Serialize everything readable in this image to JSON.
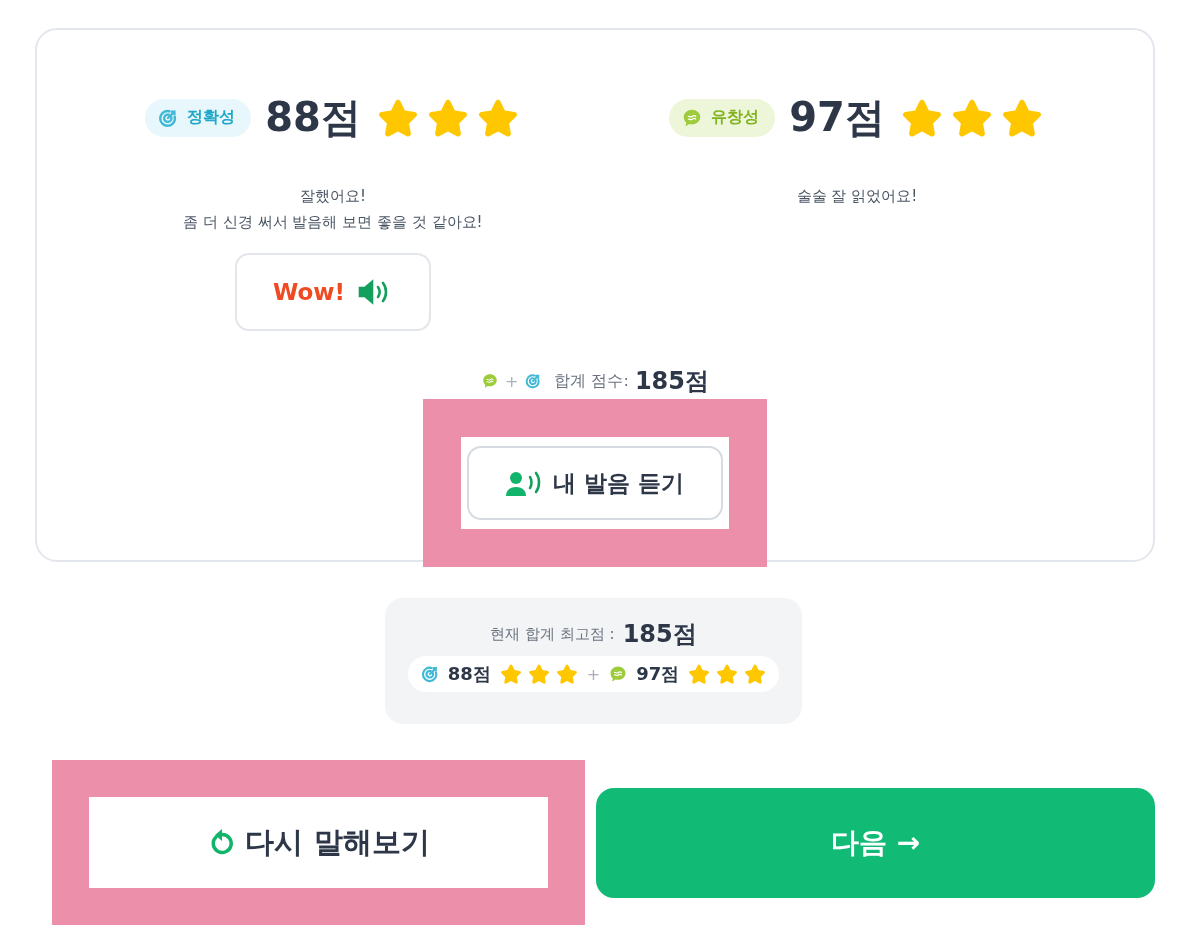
{
  "metrics": [
    {
      "kind": "accuracy",
      "label": "정확성",
      "score": "88점",
      "stars": 3,
      "feedback": [
        "잘했어요!",
        "좀 더 신경 써서 발음해 보면 좋을 것 같아요!"
      ],
      "sample_button": {
        "label": "Wow!"
      }
    },
    {
      "kind": "fluency",
      "label": "유창성",
      "score": "97점",
      "stars": 3,
      "feedback": [
        "술술 잘 읽었어요!"
      ]
    }
  ],
  "total": {
    "separator": "+",
    "label": "합계 점수:",
    "score": "185점"
  },
  "listen_button": {
    "label": "내 발음 듣기",
    "highlighted": true
  },
  "best": {
    "label": "현재 합계 최고점 :",
    "score": "185점",
    "separator": "+",
    "parts": [
      {
        "kind": "accuracy",
        "score": "88점",
        "stars": 3
      },
      {
        "kind": "fluency",
        "score": "97점",
        "stars": 3
      }
    ]
  },
  "actions": [
    {
      "kind": "retry",
      "label": "다시 말해보기",
      "highlighted": true
    },
    {
      "kind": "next",
      "label": "다음 →"
    }
  ]
}
